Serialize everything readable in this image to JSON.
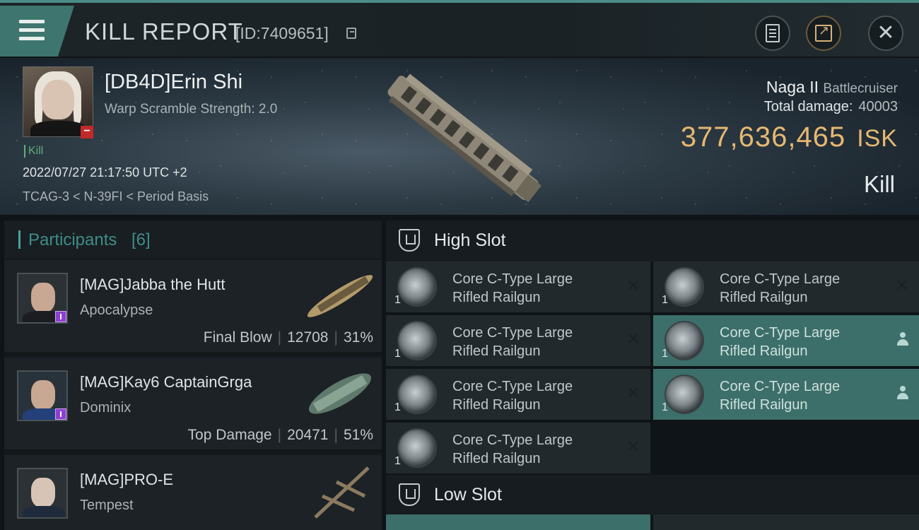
{
  "header": {
    "title": "KILL REPORT",
    "report_id": "[ID:7409651]"
  },
  "victim": {
    "name": "[DB4D]Erin Shi",
    "warp_scramble": "Warp Scramble Strength: 2.0",
    "tag": "Kill",
    "datetime": "2022/07/27 21:17:50 UTC +2",
    "location": "TCAG-3 < N-39FI < Period Basis"
  },
  "ship": {
    "name": "Naga II",
    "class": "Battlecruiser",
    "total_damage_label": "Total damage:",
    "total_damage": "40003",
    "isk_value": "377,636,465",
    "isk_unit": "ISK",
    "result": "Kill"
  },
  "participants": {
    "title": "Participants",
    "count": "[6]",
    "items": [
      {
        "name": "[MAG]Jabba the Hutt",
        "ship": "Apocalypse",
        "role": "Final Blow",
        "damage": "12708",
        "percent": "31%"
      },
      {
        "name": "[MAG]Kay6 CaptainGrga",
        "ship": "Dominix",
        "role": "Top Damage",
        "damage": "20471",
        "percent": "51%"
      },
      {
        "name": "[MAG]PRO-E",
        "ship": "Tempest",
        "role": "",
        "damage": "",
        "percent": ""
      }
    ]
  },
  "high_slot": {
    "title": "High Slot",
    "modules": [
      {
        "qty": "1",
        "line1": "Core C-Type Large",
        "line2": "Rifled Railgun",
        "state": "destroyed"
      },
      {
        "qty": "1",
        "line1": "Core C-Type Large",
        "line2": "Rifled Railgun",
        "state": "destroyed"
      },
      {
        "qty": "1",
        "line1": "Core C-Type Large",
        "line2": "Rifled Railgun",
        "state": "destroyed"
      },
      {
        "qty": "1",
        "line1": "Core C-Type Large",
        "line2": "Rifled Railgun",
        "state": "dropped"
      },
      {
        "qty": "1",
        "line1": "Core C-Type Large",
        "line2": "Rifled Railgun",
        "state": "destroyed"
      },
      {
        "qty": "1",
        "line1": "Core C-Type Large",
        "line2": "Rifled Railgun",
        "state": "dropped"
      },
      {
        "qty": "1",
        "line1": "Core C-Type Large",
        "line2": "Rifled Railgun",
        "state": "destroyed"
      }
    ]
  },
  "low_slot": {
    "title": "Low Slot"
  },
  "icons": {
    "menu": "menu-icon",
    "copy": "copy-icon",
    "clipboard": "clipboard-icon",
    "share": "share-icon",
    "close": "close-icon",
    "destroyed": "x-icon",
    "dropped": "person-icon"
  },
  "colors": {
    "accent": "#3e766f",
    "isk": "#e6b872",
    "kill_tag": "#5fae7c",
    "corp_badge": "#8c3fd0",
    "dropped_bg": "#3c6f6a"
  }
}
